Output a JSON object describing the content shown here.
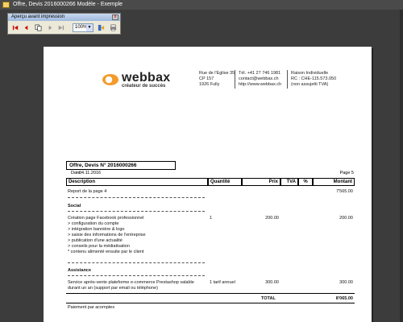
{
  "window": {
    "title": "Offre, Devis 2016000266 Modèle - Exemple"
  },
  "toolbar_window": {
    "title": "Aperçu avant impression",
    "close_label": "x",
    "zoom_value": "100%",
    "icons": [
      "first-page-icon",
      "previous-page-icon",
      "copy-icon",
      "next-page-icon",
      "last-page-icon",
      "exit-icon",
      "print-icon"
    ]
  },
  "header": {
    "brand": "webbax",
    "tagline": "créateur de succès",
    "address": [
      "Rue de l'Eglise 35",
      "CP 157",
      "1926 Fully"
    ],
    "contact": [
      "Tél. +41 27 746 1981",
      "contact@webbax.ch",
      "http://www.webbax.ch"
    ],
    "legal": [
      "Raison Individuelle",
      "RC : CHE-115.573.050",
      "(non assujetti TVA)"
    ]
  },
  "document": {
    "title": "Offre, Devis N° 2016000266",
    "date_label": "Date",
    "date_value": "04.11.2016",
    "page_label": "Page 5",
    "columns": [
      "Description",
      "Quantité",
      "Prix",
      "TVA",
      "%",
      "Montant"
    ],
    "report_label": "Report de la page 4",
    "report_value": "7'565.00",
    "section1": "Social",
    "item1": {
      "lines": [
        "Création page Facebook professionnel",
        "> configuration du compte",
        "> intégration bannière & logo",
        "> saisie des informations de l'entreprise",
        "> publication d'une actualité",
        "> conseils pour la médiatisation",
        "* contenu alimenté ensuite par le client"
      ],
      "qty": "1",
      "price": "200.00",
      "amount": "200.00"
    },
    "section2": "Assistance",
    "item2": {
      "lines": [
        "Service après-vente plateforme e-commerce Prestashop valable",
        "durant un an (support par email ou téléphone)"
      ],
      "qty": "1 tarif annuel",
      "price": "300.00",
      "amount": "300.00"
    },
    "total_label": "TOTAL",
    "total_value": "8'065.00",
    "payment_note": "Paiement par acomptes"
  }
}
